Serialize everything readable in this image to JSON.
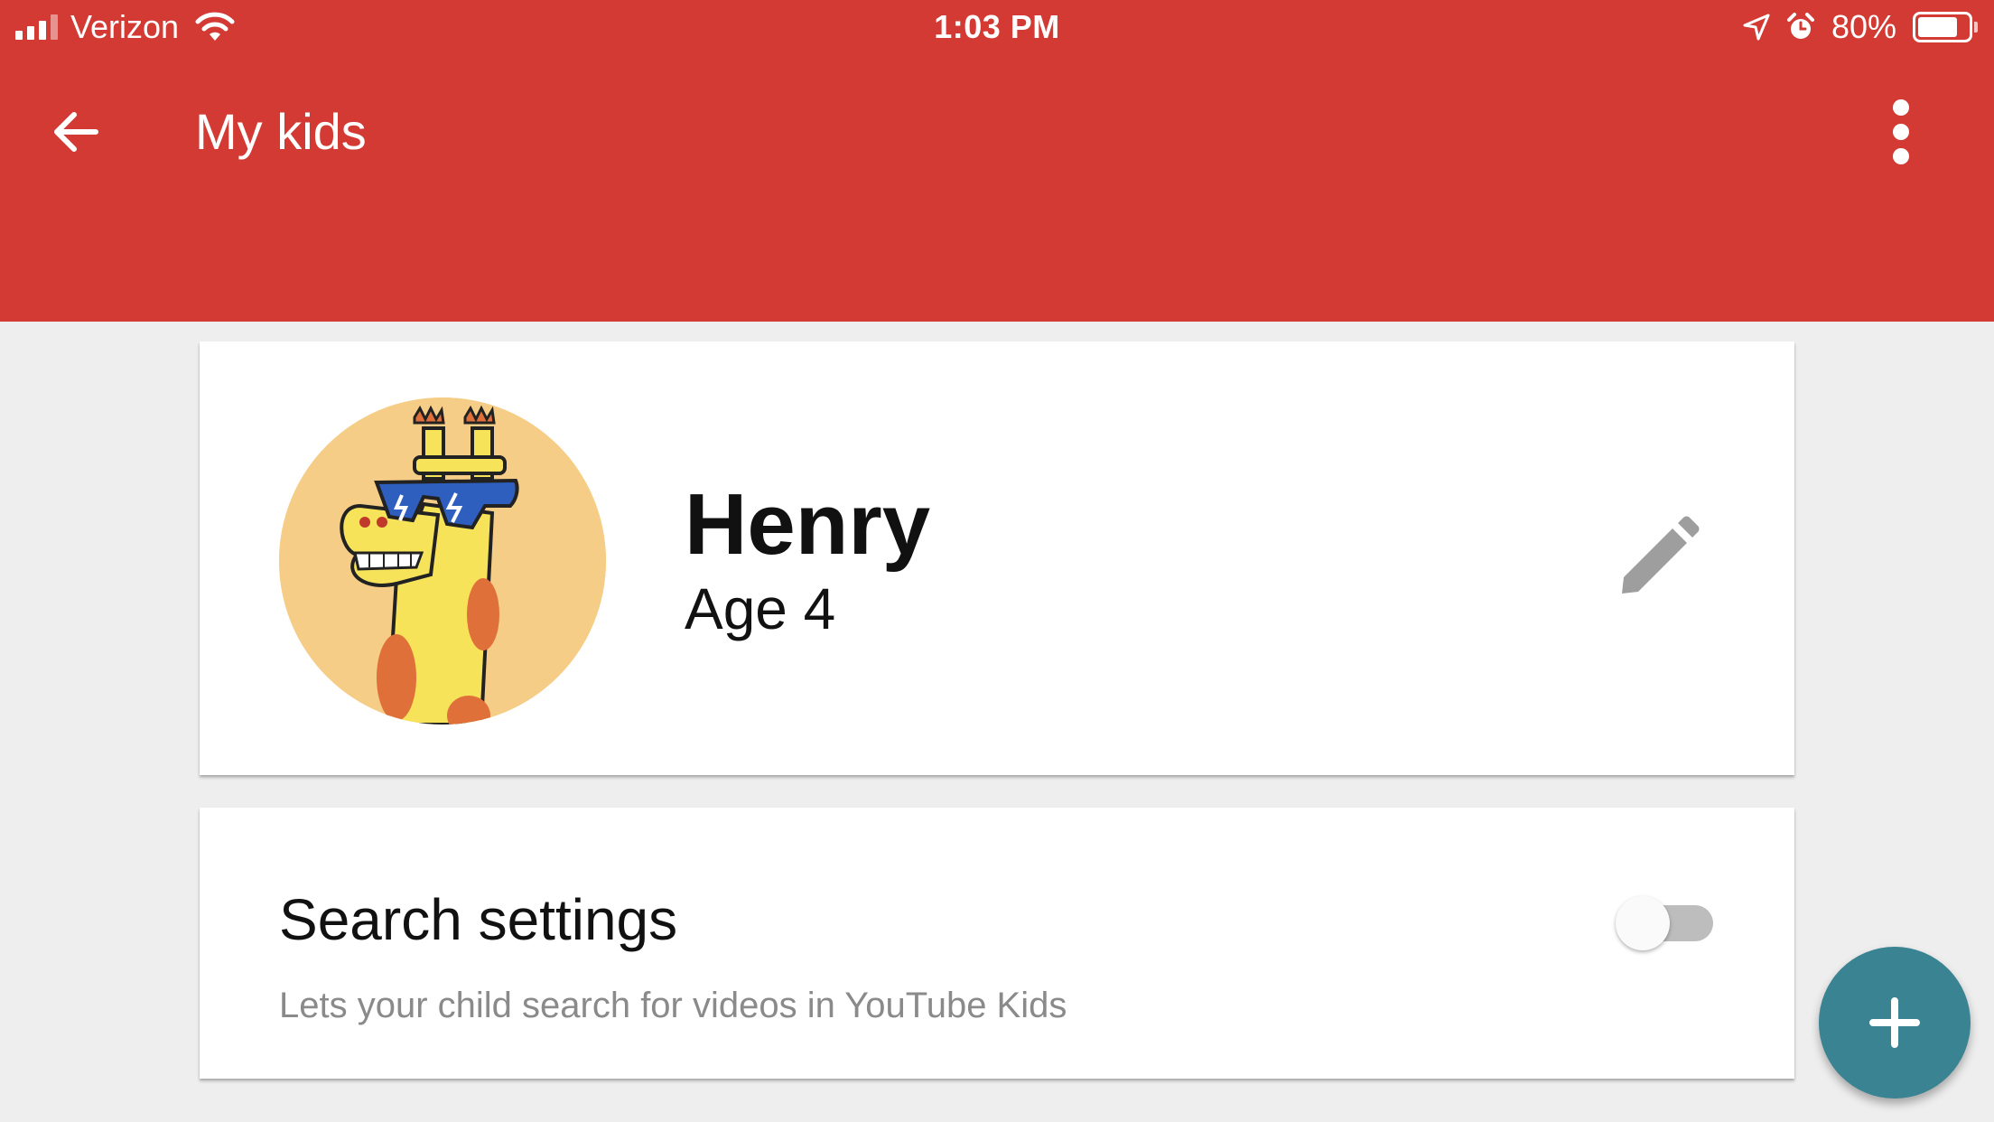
{
  "status_bar": {
    "carrier": "Verizon",
    "time": "1:03 PM",
    "battery_percent": "80%",
    "battery_level": 0.8,
    "icons": [
      "signal-icon",
      "wifi-icon",
      "location-arrow-icon",
      "alarm-icon",
      "battery-icon"
    ]
  },
  "toolbar": {
    "title": "My kids",
    "back_icon": "arrow-back-icon",
    "more_icon": "more-vert-icon",
    "color": "#d23a33"
  },
  "profile": {
    "name": "Henry",
    "age": "Age 4",
    "avatar": "giraffe-with-sunglasses",
    "avatar_bg": "#f6cd86",
    "edit_icon": "pencil-icon"
  },
  "search_settings": {
    "title": "Search settings",
    "description": "Lets your child search for videos in YouTube Kids",
    "enabled": false
  },
  "fab": {
    "icon": "plus-icon",
    "color": "#3a8392"
  }
}
